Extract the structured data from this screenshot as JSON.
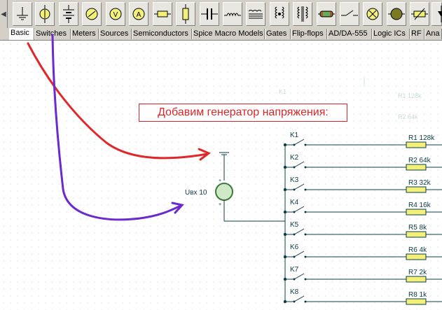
{
  "toolbar": {
    "tools": [
      {
        "icon": "ground-icon"
      },
      {
        "icon": "lamp-icon"
      },
      {
        "icon": "battery-icon"
      },
      {
        "icon": "meter-icon"
      },
      {
        "icon": "voltmeter-icon"
      },
      {
        "icon": "ammeter-icon"
      },
      {
        "icon": "resistor-icon"
      },
      {
        "icon": "potentiometer-icon"
      },
      {
        "icon": "capacitor-icon"
      },
      {
        "icon": "inductor-icon"
      },
      {
        "icon": "transformer-icon"
      },
      {
        "icon": "coupled-inductor-icon"
      },
      {
        "icon": "transformer-core-icon"
      },
      {
        "icon": "fuse-icon"
      },
      {
        "icon": "switch-icon"
      },
      {
        "icon": "lamp-cross-icon"
      },
      {
        "icon": "motor-icon"
      },
      {
        "icon": "variable-resistor-icon"
      },
      {
        "icon": "diode-icon"
      }
    ]
  },
  "tabs": [
    "Basic",
    "Switches",
    "Meters",
    "Sources",
    "Semiconductors",
    "Spice Macro Models",
    "Gates",
    "Flip-flops",
    "AD/DA-555",
    "Logic ICs",
    "RF",
    "Ana"
  ],
  "annotation": "Добавим генератор напряжения:",
  "source": {
    "label": "Uвх 10"
  },
  "switches": [
    "K1",
    "K2",
    "K3",
    "K4",
    "K5",
    "K6",
    "K7",
    "K8"
  ],
  "resistors": [
    "R1 128k",
    "R2 64k",
    "R3 32k",
    "R4 16k",
    "R5 8k",
    "R6 4k",
    "R7 2k",
    "R8 1k"
  ],
  "ghost": {
    "k": "K1",
    "r1": "R1 128k",
    "r2": "R2 64k"
  },
  "colors": {
    "wire": "#0a3c46",
    "red_arrow": "#e0282a",
    "purple_arrow": "#6a2ad0",
    "component_fill": "#f3f07a",
    "source_fill": "#cfe8c8"
  }
}
